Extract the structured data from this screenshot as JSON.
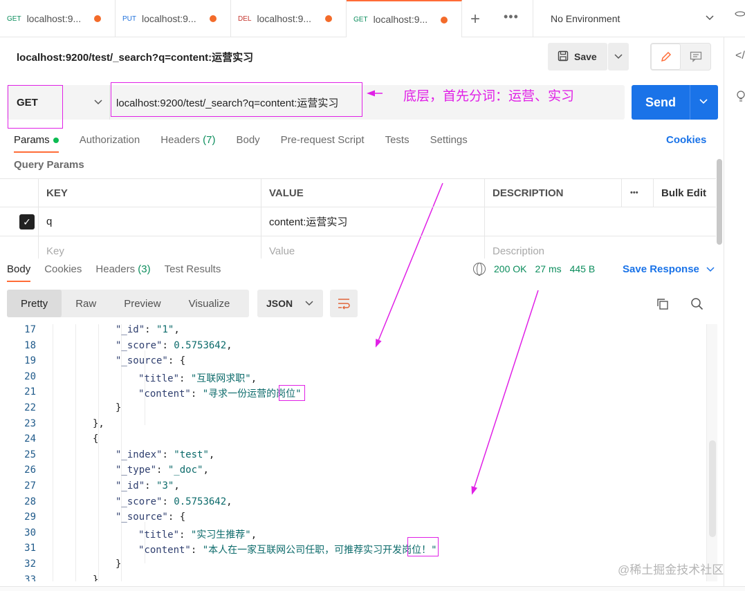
{
  "tabs": [
    {
      "method": "GET",
      "title": "localhost:9...",
      "color": "#0b8d5c"
    },
    {
      "method": "PUT",
      "title": "localhost:9...",
      "color": "#1c6fdb"
    },
    {
      "method": "DEL",
      "title": "localhost:9...",
      "color": "#c4322b"
    },
    {
      "method": "GET",
      "title": "localhost:9...",
      "color": "#0b8d5c",
      "active": true
    }
  ],
  "environment": "No Environment",
  "request": {
    "title": "localhost:9200/test/_search?q=content:运营实习",
    "method": "GET",
    "url": "localhost:9200/test/_search?q=content:运营实习",
    "save_label": "Save",
    "send_label": "Send"
  },
  "annotation": {
    "arrow_text": "底层，首先分词：运营、实习",
    "color": "#e020e6"
  },
  "request_tabs": {
    "params": "Params",
    "authorization": "Authorization",
    "headers": "Headers",
    "headers_count": "(7)",
    "body": "Body",
    "prerequest": "Pre-request Script",
    "tests": "Tests",
    "settings": "Settings",
    "cookies": "Cookies"
  },
  "query_params": {
    "title": "Query Params",
    "headers": {
      "key": "KEY",
      "value": "VALUE",
      "description": "DESCRIPTION",
      "more": "•••",
      "bulk_edit": "Bulk Edit"
    },
    "rows": [
      {
        "checked": true,
        "key": "q",
        "value": "content:运营实习",
        "description": ""
      }
    ],
    "placeholders": {
      "key": "Key",
      "value": "Value",
      "description": "Description"
    }
  },
  "response": {
    "tabs": {
      "body": "Body",
      "cookies": "Cookies",
      "headers": "Headers",
      "headers_count": "(3)",
      "test_results": "Test Results"
    },
    "status": "200 OK",
    "time": "27 ms",
    "size": "445 B",
    "save_response": "Save Response",
    "views": [
      "Pretty",
      "Raw",
      "Preview",
      "Visualize"
    ],
    "active_view": "Pretty",
    "format": "JSON",
    "lines": [
      {
        "n": "17",
        "indent": 3,
        "parts": [
          [
            "k",
            "\"_id\""
          ],
          [
            "p",
            ": "
          ],
          [
            "s",
            "\"1\""
          ],
          [
            "p",
            ","
          ]
        ]
      },
      {
        "n": "18",
        "indent": 3,
        "parts": [
          [
            "k",
            "\"_score\""
          ],
          [
            "p",
            ": "
          ],
          [
            "n",
            "0.5753642"
          ],
          [
            "p",
            ","
          ]
        ]
      },
      {
        "n": "19",
        "indent": 3,
        "parts": [
          [
            "k",
            "\"_source\""
          ],
          [
            "p",
            ": {"
          ]
        ]
      },
      {
        "n": "20",
        "indent": 4,
        "parts": [
          [
            "k",
            "\"title\""
          ],
          [
            "p",
            ": "
          ],
          [
            "s",
            "\"互联网求职\""
          ],
          [
            "p",
            ","
          ]
        ]
      },
      {
        "n": "21",
        "indent": 4,
        "parts": [
          [
            "k",
            "\"content\""
          ],
          [
            "p",
            ": "
          ],
          [
            "s",
            "\"寻求一份运营的岗位\""
          ]
        ]
      },
      {
        "n": "22",
        "indent": 3,
        "parts": [
          [
            "p",
            "}"
          ]
        ]
      },
      {
        "n": "23",
        "indent": 2,
        "parts": [
          [
            "p",
            "},"
          ]
        ]
      },
      {
        "n": "24",
        "indent": 2,
        "parts": [
          [
            "p",
            "{"
          ]
        ]
      },
      {
        "n": "25",
        "indent": 3,
        "parts": [
          [
            "k",
            "\"_index\""
          ],
          [
            "p",
            ": "
          ],
          [
            "s",
            "\"test\""
          ],
          [
            "p",
            ","
          ]
        ]
      },
      {
        "n": "26",
        "indent": 3,
        "parts": [
          [
            "k",
            "\"_type\""
          ],
          [
            "p",
            ": "
          ],
          [
            "s",
            "\"_doc\""
          ],
          [
            "p",
            ","
          ]
        ]
      },
      {
        "n": "27",
        "indent": 3,
        "parts": [
          [
            "k",
            "\"_id\""
          ],
          [
            "p",
            ": "
          ],
          [
            "s",
            "\"3\""
          ],
          [
            "p",
            ","
          ]
        ]
      },
      {
        "n": "28",
        "indent": 3,
        "parts": [
          [
            "k",
            "\"_score\""
          ],
          [
            "p",
            ": "
          ],
          [
            "n",
            "0.5753642"
          ],
          [
            "p",
            ","
          ]
        ]
      },
      {
        "n": "29",
        "indent": 3,
        "parts": [
          [
            "k",
            "\"_source\""
          ],
          [
            "p",
            ": {"
          ]
        ]
      },
      {
        "n": "30",
        "indent": 4,
        "parts": [
          [
            "k",
            "\"title\""
          ],
          [
            "p",
            ": "
          ],
          [
            "s",
            "\"实习生推荐\""
          ],
          [
            "p",
            ","
          ]
        ]
      },
      {
        "n": "31",
        "indent": 4,
        "parts": [
          [
            "k",
            "\"content\""
          ],
          [
            "p",
            ": "
          ],
          [
            "s",
            "\"本人在一家互联网公司任职，可推荐实习开发岗位！\""
          ]
        ]
      },
      {
        "n": "32",
        "indent": 3,
        "parts": [
          [
            "p",
            "}"
          ]
        ]
      },
      {
        "n": "33",
        "indent": 2,
        "parts": [
          [
            "p",
            "}"
          ]
        ]
      }
    ]
  },
  "watermark": "@稀土掘金技术社区",
  "icons": {
    "edit": "pencil-icon",
    "comment": "comment-icon",
    "save": "floppy-icon",
    "copy": "copy-icon",
    "search": "search-icon",
    "wrap": "wrap-lines-icon",
    "globe": "globe-icon"
  }
}
